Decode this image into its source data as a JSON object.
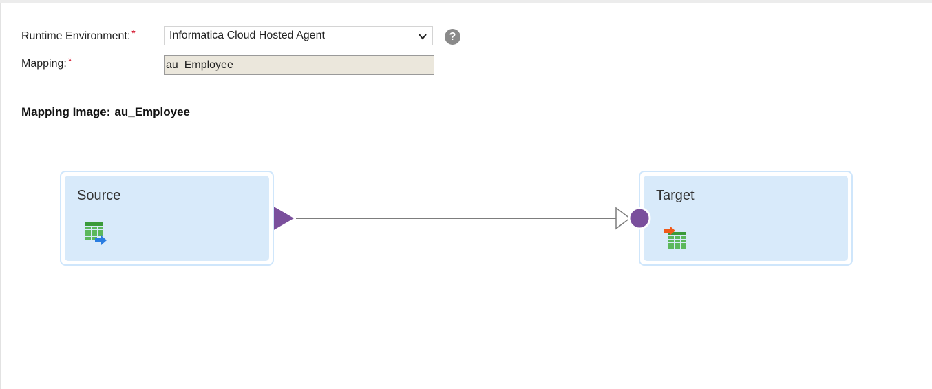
{
  "form": {
    "runtime_label": "Runtime Environment:",
    "runtime_required": "*",
    "runtime_value": "Informatica Cloud Hosted Agent",
    "mapping_label": "Mapping:",
    "mapping_required": "*",
    "mapping_value": "au_Employee",
    "help_glyph": "?"
  },
  "section": {
    "title": "Mapping Image:",
    "mapping_name": "au_Employee"
  },
  "diagram": {
    "source": {
      "title": "Source",
      "icon": "source-table-icon"
    },
    "target": {
      "title": "Target",
      "icon": "target-table-icon"
    },
    "connector_color": "#7a4f9c",
    "node_fill": "#d8eafa",
    "node_border": "#cfe6fb"
  }
}
